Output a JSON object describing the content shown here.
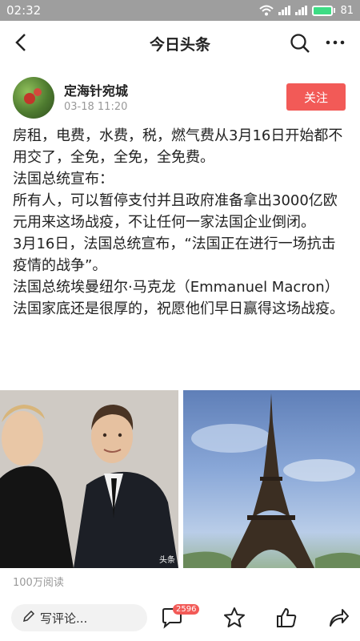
{
  "status_bar": {
    "time": "02:32",
    "battery": "81"
  },
  "nav": {
    "title": "今日头条"
  },
  "author": {
    "name": "定海针宛城",
    "date": "03-18 11:20",
    "follow_label": "关注"
  },
  "article": {
    "paragraphs": [
      "房租，电费，水费，税，燃气费从3月16日开始都不用交了，全免，全免，全免费。",
      "法国总统宣布：",
      "所有人，可以暂停支付并且政府准备拿出3000亿欧元用来这场战疫，不让任何一家法国企业倒闭。",
      "3月16日，法国总统宣布，“法国正在进行一场抗击疫情的战争”。",
      "法国总统埃曼纽尔·马克龙（Emmanuel Macron）",
      "法国家底还是很厚的，祝愿他们早日赢得这场战疫。"
    ]
  },
  "photos": {
    "watermark": "头条"
  },
  "stats": {
    "read_count": "100万阅读"
  },
  "bottom_bar": {
    "comment_placeholder": "写评论...",
    "comment_count": "2596"
  },
  "icons": [
    "back-arrow-icon",
    "search-icon",
    "more-icon",
    "wifi-icon",
    "signal-icon",
    "battery-icon",
    "pencil-icon",
    "comment-icon",
    "star-icon",
    "thumbs-up-icon",
    "share-icon"
  ],
  "colors": {
    "accent": "#f25a57",
    "status_bar": "#9e9e9e"
  }
}
